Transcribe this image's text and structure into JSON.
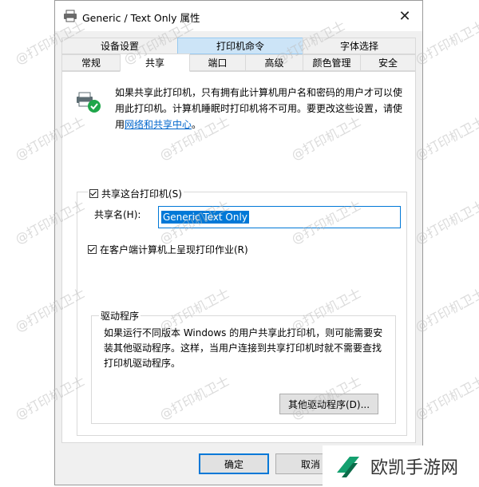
{
  "window": {
    "title": "Generic / Text Only 属性",
    "close_glyph": "✕"
  },
  "tabs_row1": [
    {
      "label": "设备设置"
    },
    {
      "label": "打印机命令"
    },
    {
      "label": "字体选择"
    }
  ],
  "tabs_row2": [
    {
      "label": "常规"
    },
    {
      "label": "共享"
    },
    {
      "label": "端口"
    },
    {
      "label": "高级"
    },
    {
      "label": "颜色管理"
    },
    {
      "label": "安全"
    }
  ],
  "active_tab": "共享",
  "info": {
    "line1": "如果共享此打印机，只有拥有此计算机用户名和密码的用户才可以使",
    "line2": "用此打印机。计算机睡眠时打印机将不可用。要更改这些设置，请使",
    "line3_prefix": "用",
    "link": "网络和共享中心",
    "line3_suffix": "。"
  },
  "share": {
    "checkbox_label": "共享这台打印机(S)",
    "checked": true,
    "name_label": "共享名(H):",
    "name_value": "Generic  Text Only",
    "render_label": "在客户端计算机上呈现打印作业(R)",
    "render_checked": true
  },
  "driver": {
    "legend": "驱动程序",
    "line1": "如果运行不同版本 Windows 的用户共享此打印机，则可能需要安",
    "line2": "装其他驱动程序。这样，当用户连接到共享打印机时就不需要查找",
    "line3": "打印机驱动程序。",
    "button": "其他驱动程序(D)..."
  },
  "buttons": {
    "ok": "确定",
    "cancel": "取消"
  },
  "watermark": "@打印机卫士",
  "brand": {
    "name": "欧凯手游网",
    "color": "#14a06f"
  },
  "icons": {
    "title": "printer-icon",
    "share": "shared-printer-icon"
  }
}
